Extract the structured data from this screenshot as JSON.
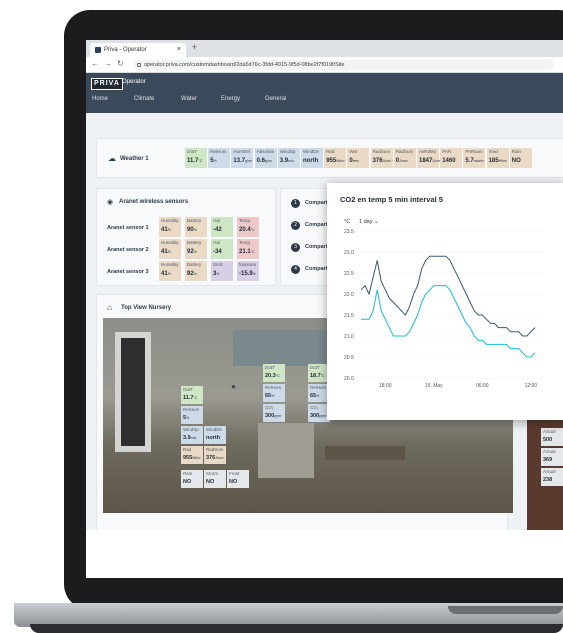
{
  "browser": {
    "tab_title": "Priva - Operator",
    "url": "operator.priva.com/customdashboard/2da5d76c-3fdd-4015-9f5d-08be2f7f019f/Site"
  },
  "app": {
    "logo": "PRIVA",
    "name": "Operator",
    "menu": [
      "Home",
      "Climate",
      "Water",
      "Energy",
      "General"
    ]
  },
  "weather": {
    "title": "Weather 1",
    "tiles": [
      {
        "label": "OutT",
        "value": "11.7",
        "unit": "°C",
        "color": "#cfe6c4"
      },
      {
        "label": "RelHum",
        "value": "5",
        "unit": "%",
        "color": "#cddbe8"
      },
      {
        "label": "HumDef",
        "value": "13.7",
        "unit": "g/m³",
        "color": "#cddbe8"
      },
      {
        "label": "Absolute",
        "value": "0.6",
        "unit": "g/m³",
        "color": "#cddbe8"
      },
      {
        "label": "WindSp",
        "value": "3.9",
        "unit": "m/s",
        "color": "#cddbe8"
      },
      {
        "label": "WindDir",
        "value": "north",
        "unit": "",
        "color": "#cddbe8"
      },
      {
        "label": "Rad",
        "value": "955",
        "unit": "W/m²",
        "color": "#ead9c4"
      },
      {
        "label": "Wet",
        "value": "0",
        "unit": "mm",
        "color": "#ead9c4"
      },
      {
        "label": "RadSum",
        "value": "376",
        "unit": "J/cm²",
        "color": "#ead9c4"
      },
      {
        "label": "RadSum",
        "value": "0",
        "unit": "J/cm²",
        "color": "#ead9c4"
      },
      {
        "label": "AvRdMo",
        "value": "1847",
        "unit": "J/cm²",
        "color": "#ead9c4"
      },
      {
        "label": "PAR",
        "value": "1460",
        "unit": "",
        "color": "#ead9c4"
      },
      {
        "label": "PARsum",
        "value": "5.7",
        "unit": "mol/m²",
        "color": "#ead9c4"
      },
      {
        "label": "Irrad",
        "value": "185",
        "unit": "W/m²",
        "color": "#ead9c4"
      },
      {
        "label": "Rain",
        "value": "NO",
        "unit": "",
        "color": "#ead9c4"
      }
    ]
  },
  "sensors": {
    "title": "Aranet wireless sensors",
    "rows": [
      {
        "name": "Aranet sensor 1",
        "tiles": [
          {
            "label": "Humidity",
            "value": "41",
            "unit": "%",
            "color": "#ead9c4"
          },
          {
            "label": "Battery",
            "value": "90",
            "unit": "%",
            "color": "#ead9c4"
          },
          {
            "label": "rssi",
            "value": "-42",
            "unit": "",
            "color": "#cfe6c4"
          },
          {
            "label": "Temp",
            "value": "20.4",
            "unit": "°C",
            "color": "#efc9c9"
          }
        ]
      },
      {
        "name": "Aranet sensor 2",
        "tiles": [
          {
            "label": "Humidity",
            "value": "41",
            "unit": "%",
            "color": "#ead9c4"
          },
          {
            "label": "Battery",
            "value": "92",
            "unit": "%",
            "color": "#ead9c4"
          },
          {
            "label": "rssi",
            "value": "-34",
            "unit": "",
            "color": "#cfe6c4"
          },
          {
            "label": "Temp",
            "value": "21.1",
            "unit": "°C",
            "color": "#efc9c9"
          }
        ]
      },
      {
        "name": "Aranet sensor 3",
        "tiles": [
          {
            "label": "Humidity",
            "value": "41",
            "unit": "%",
            "color": "#ead9c4"
          },
          {
            "label": "Battery",
            "value": "92",
            "unit": "%",
            "color": "#ead9c4"
          },
          {
            "label": "SmS",
            "value": "3",
            "unit": "%",
            "color": "#d8cfe6"
          },
          {
            "label": "Moisture",
            "value": "-15.9",
            "unit": "%",
            "color": "#d8cfe6"
          }
        ]
      }
    ]
  },
  "compartments": [
    {
      "num": "1",
      "label": "Compart"
    },
    {
      "num": "2",
      "label": "Compart"
    },
    {
      "num": "3",
      "label": "Compart"
    },
    {
      "num": "4",
      "label": "Compart"
    }
  ],
  "nursery": {
    "title": "Top View Nursery",
    "tiles": [
      {
        "label": "OutT",
        "value": "11.7",
        "unit": "°C",
        "color": "#cfe6c4"
      },
      {
        "label": "RelHum",
        "value": "5",
        "unit": "%",
        "color": "#cddbe8"
      },
      {
        "label": "WindSp",
        "value": "3.9",
        "unit": "m/s",
        "color": "#cddbe8"
      },
      {
        "label": "WindDir",
        "value": "north",
        "unit": "",
        "color": "#cddbe8"
      },
      {
        "label": "Rad",
        "value": "955",
        "unit": "W/m²",
        "color": "#ead9c4"
      },
      {
        "label": "RadSum",
        "value": "376",
        "unit": "J/cm²",
        "color": "#ead9c4"
      },
      {
        "label": "Rain",
        "value": "NO",
        "unit": "",
        "color": "#e5e8eb"
      },
      {
        "label": "Storm",
        "value": "NO",
        "unit": "",
        "color": "#e5e8eb"
      },
      {
        "label": "Frost",
        "value": "NO",
        "unit": "",
        "color": "#e5e8eb"
      },
      {
        "label": "DotT",
        "value": "20.3",
        "unit": "°C",
        "color": "#cfe6c4"
      },
      {
        "label": "RelHum",
        "value": "65",
        "unit": "%",
        "color": "#cddbe8"
      },
      {
        "label": "CO₂",
        "value": "300",
        "unit": "ppm",
        "color": "#cddbe8"
      },
      {
        "label": "DotT",
        "value": "18.7",
        "unit": "°C",
        "color": "#cfe6c4"
      },
      {
        "label": "RelHum",
        "value": "65",
        "unit": "%",
        "color": "#cddbe8"
      },
      {
        "label": "CO₂",
        "value": "300",
        "unit": "ppm",
        "color": "#cddbe8"
      }
    ]
  },
  "side_tiles": [
    {
      "label": "Actual",
      "value": "500"
    },
    {
      "label": "Actual",
      "value": "369"
    },
    {
      "label": "Actual",
      "value": "238"
    }
  ],
  "popup": {
    "title": "CO2 en temp 5 min interval 5",
    "unit": "°C",
    "range": "1 day"
  },
  "chart_data": {
    "type": "line",
    "title": "CO2 en temp 5 min interval 5",
    "ylabel": "°C",
    "ylim": [
      20.0,
      23.5
    ],
    "yticks": [
      "23.5",
      "23.0",
      "22.5",
      "22.0",
      "21.5",
      "21.0",
      "20.5",
      "20.0"
    ],
    "xticks": [
      {
        "label": "18:00",
        "t": 3
      },
      {
        "label": "19. May",
        "t": 9
      },
      {
        "label": "06:00",
        "t": 15
      },
      {
        "label": "12:00",
        "t": 21
      }
    ],
    "x_range": [
      0,
      22.5
    ],
    "series": [
      {
        "color": "#3b5770",
        "x": [
          0,
          0.5,
          1,
          1.5,
          2,
          2.5,
          3,
          3.5,
          4,
          4.5,
          5,
          5.5,
          6,
          6.5,
          7,
          7.5,
          8,
          8.5,
          9,
          9.5,
          10,
          10.5,
          11,
          11.5,
          12,
          12.5,
          13,
          13.5,
          14,
          14.5,
          15,
          15.5,
          16,
          16.5,
          17,
          17.5,
          18,
          18.5,
          19,
          19.5,
          20,
          20.5,
          21,
          21.5
        ],
        "values": [
          22.1,
          22.2,
          22.0,
          22.4,
          22.8,
          22.3,
          22.1,
          21.9,
          21.8,
          21.7,
          21.6,
          21.5,
          21.7,
          22.0,
          22.2,
          22.6,
          22.8,
          22.9,
          22.9,
          22.9,
          22.9,
          22.9,
          22.8,
          22.6,
          22.4,
          22.2,
          22.0,
          21.8,
          21.6,
          21.5,
          21.5,
          21.4,
          21.3,
          21.3,
          21.2,
          21.2,
          21.2,
          21.1,
          21.1,
          21.1,
          21.0,
          21.0,
          21.1,
          21.2
        ]
      },
      {
        "color": "#22b8cf",
        "x": [
          0,
          0.5,
          1,
          1.5,
          2,
          2.5,
          3,
          3.5,
          4,
          4.5,
          5,
          5.5,
          6,
          6.5,
          7,
          7.5,
          8,
          8.5,
          9,
          9.5,
          10,
          10.5,
          11,
          11.5,
          12,
          12.5,
          13,
          13.5,
          14,
          14.5,
          15,
          15.5,
          16,
          16.5,
          17,
          17.5,
          18,
          18.5,
          19,
          19.5,
          20,
          20.5,
          21,
          21.5
        ],
        "values": [
          21.4,
          21.4,
          21.4,
          21.6,
          22.1,
          21.6,
          21.4,
          21.2,
          21.0,
          21.0,
          21.0,
          21.0,
          21.1,
          21.3,
          21.5,
          21.8,
          22.0,
          22.1,
          22.2,
          22.2,
          22.2,
          22.2,
          22.1,
          21.9,
          21.7,
          21.5,
          21.3,
          21.2,
          21.0,
          20.9,
          20.9,
          20.8,
          20.8,
          20.8,
          20.8,
          20.8,
          20.8,
          20.7,
          20.7,
          20.7,
          20.6,
          20.5,
          20.5,
          20.6
        ]
      }
    ]
  }
}
